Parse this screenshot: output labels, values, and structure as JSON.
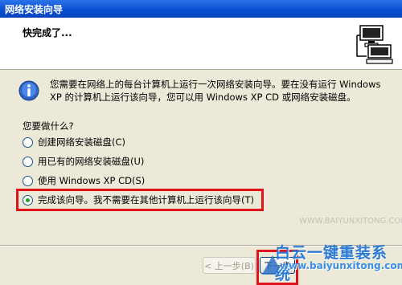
{
  "window": {
    "title": "网络安装向导"
  },
  "header": {
    "heading": "快完成了..."
  },
  "info": {
    "text": "您需要在网络上的每台计算机上运行一次网络安装向导。要在没有运行 Windows XP 的计算机上运行该向导，您可以用 Windows XP CD 或网络安装磁盘。"
  },
  "question": "您要做什么?",
  "options": [
    {
      "label": "创建网络安装磁盘(C)",
      "checked": false
    },
    {
      "label": "用已有的网络安装磁盘(U)",
      "checked": false
    },
    {
      "label": "使用 Windows XP CD(S)",
      "checked": false
    },
    {
      "label": "完成该向导。我不需要在其他计算机上运行该向导(T)",
      "checked": true
    }
  ],
  "buttons": {
    "back": "< 上一步(B)",
    "next": "下一步"
  },
  "watermark": {
    "text": "白云一键重装系统",
    "url": "www.baiyunxitong.com",
    "faint": "WWW.BAIYUNXITONG.COM"
  },
  "colors": {
    "title_bar": "#0a4fd2",
    "highlight": "#e0141c",
    "radio_dot": "#21a121"
  },
  "icons": {
    "header": "network-computers-icon",
    "info": "info-icon"
  }
}
